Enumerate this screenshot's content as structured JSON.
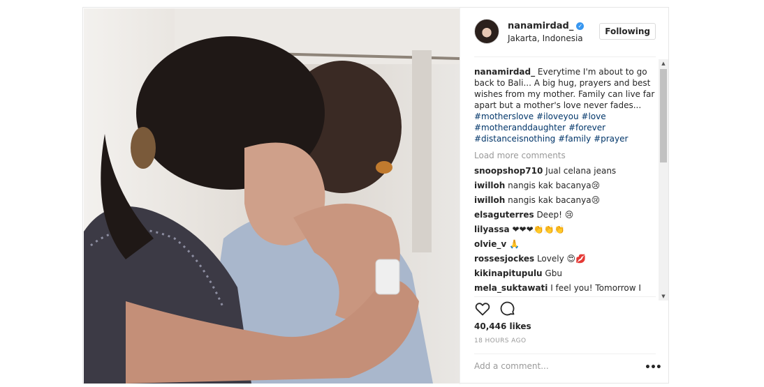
{
  "post": {
    "username": "nanamirdad_",
    "location": "Jakarta, Indonesia",
    "follow_label": "Following",
    "caption": {
      "username": "nanamirdad_",
      "text": " Everytime I'm about to go back to Bali... A big hug, prayers and best wishes from my mother. Family can live far apart but a mother's love never fades... ",
      "hashtags": [
        "#motherslove",
        "#iloveyou",
        "#love",
        "#motheranddaughter",
        "#forever",
        "#distanceisnothing",
        "#family",
        "#prayer"
      ]
    },
    "load_more": "Load more comments",
    "comments": [
      {
        "user": "snoopshop710",
        "text": " Jual celana jeans"
      },
      {
        "user": "iwilloh",
        "text": " nangis kak bacanya😢"
      },
      {
        "user": "iwilloh",
        "text": " nangis kak bacanya😢"
      },
      {
        "user": "elsaguterres",
        "text": " Deep! 😢"
      },
      {
        "user": "lilyassa",
        "text": " ❤❤❤👏👏👏"
      },
      {
        "user": "olvie_v",
        "text": " 🙏"
      },
      {
        "user": "rossesjockes",
        "text": " Lovely 😍💋"
      },
      {
        "user": "kikinapitupulu",
        "text": " Gbu"
      },
      {
        "user": "mela_suktawati",
        "text": " I feel you! Tomorrow I"
      }
    ],
    "likes": "40,446 likes",
    "time": "18 HOURS AGO",
    "add_comment_placeholder": "Add a comment...",
    "more_icon": "•••"
  },
  "colors": {
    "hashtag": "#003569",
    "verified": "#3897f0"
  }
}
